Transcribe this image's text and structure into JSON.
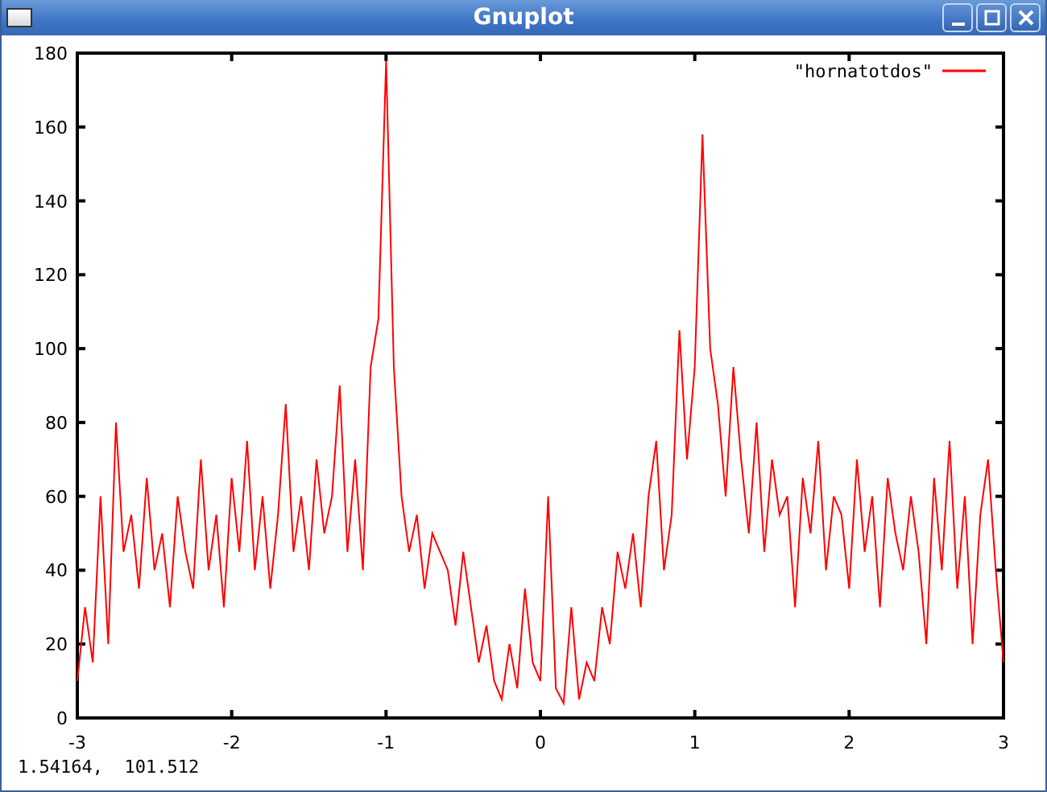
{
  "window": {
    "title": "Gnuplot"
  },
  "plot": {
    "chart_data": {
      "type": "line",
      "xlim": [
        -3,
        3
      ],
      "ylim": [
        0,
        180
      ],
      "xticks": [
        -3,
        -2,
        -1,
        0,
        1,
        2,
        3
      ],
      "yticks": [
        0,
        20,
        40,
        60,
        80,
        100,
        120,
        140,
        160,
        180
      ],
      "x": [
        -3,
        -2.95,
        -2.9,
        -2.85,
        -2.8,
        -2.75,
        -2.7,
        -2.65,
        -2.6,
        -2.55,
        -2.5,
        -2.45,
        -2.4,
        -2.35,
        -2.3,
        -2.25,
        -2.2,
        -2.15,
        -2.1,
        -2.05,
        -2,
        -1.95,
        -1.9,
        -1.85,
        -1.8,
        -1.75,
        -1.7,
        -1.65,
        -1.6,
        -1.55,
        -1.5,
        -1.45,
        -1.4,
        -1.35,
        -1.3,
        -1.25,
        -1.2,
        -1.15,
        -1.1,
        -1.05,
        -1,
        -0.95,
        -0.9,
        -0.85,
        -0.8,
        -0.75,
        -0.7,
        -0.65,
        -0.6,
        -0.55,
        -0.5,
        -0.45,
        -0.4,
        -0.35,
        -0.3,
        -0.25,
        -0.2,
        -0.15,
        -0.1,
        -0.05,
        0,
        0.05,
        0.1,
        0.15,
        0.2,
        0.25,
        0.3,
        0.35,
        0.4,
        0.45,
        0.5,
        0.55,
        0.6,
        0.65,
        0.7,
        0.75,
        0.8,
        0.85,
        0.9,
        0.95,
        1,
        1.05,
        1.1,
        1.15,
        1.2,
        1.25,
        1.3,
        1.35,
        1.4,
        1.45,
        1.5,
        1.55,
        1.6,
        1.65,
        1.7,
        1.75,
        1.8,
        1.85,
        1.9,
        1.95,
        2,
        2.05,
        2.1,
        2.15,
        2.2,
        2.25,
        2.3,
        2.35,
        2.4,
        2.45,
        2.5,
        2.55,
        2.6,
        2.65,
        2.7,
        2.75,
        2.8,
        2.85,
        2.9,
        2.95,
        3
      ],
      "series": [
        {
          "name": "\"hornatotdos\"",
          "color": "#ff0000",
          "values": [
            10,
            30,
            15,
            60,
            20,
            80,
            45,
            55,
            35,
            65,
            40,
            50,
            30,
            60,
            45,
            35,
            70,
            40,
            55,
            30,
            65,
            45,
            75,
            40,
            60,
            35,
            55,
            85,
            45,
            60,
            40,
            70,
            50,
            60,
            90,
            45,
            70,
            40,
            95,
            108,
            178,
            95,
            60,
            45,
            55,
            35,
            50,
            45,
            40,
            25,
            45,
            30,
            15,
            25,
            10,
            5,
            20,
            8,
            35,
            15,
            10,
            60,
            8,
            4,
            30,
            5,
            15,
            10,
            30,
            20,
            45,
            35,
            50,
            30,
            60,
            75,
            40,
            55,
            105,
            70,
            95,
            158,
            100,
            85,
            60,
            95,
            70,
            50,
            80,
            45,
            70,
            55,
            60,
            30,
            65,
            50,
            75,
            40,
            60,
            55,
            35,
            70,
            45,
            60,
            30,
            65,
            50,
            40,
            60,
            45,
            20,
            65,
            40,
            75,
            35,
            60,
            20,
            55,
            70,
            40,
            15
          ]
        }
      ]
    }
  },
  "status_bar": {
    "text": "1.54164,  101.512"
  }
}
